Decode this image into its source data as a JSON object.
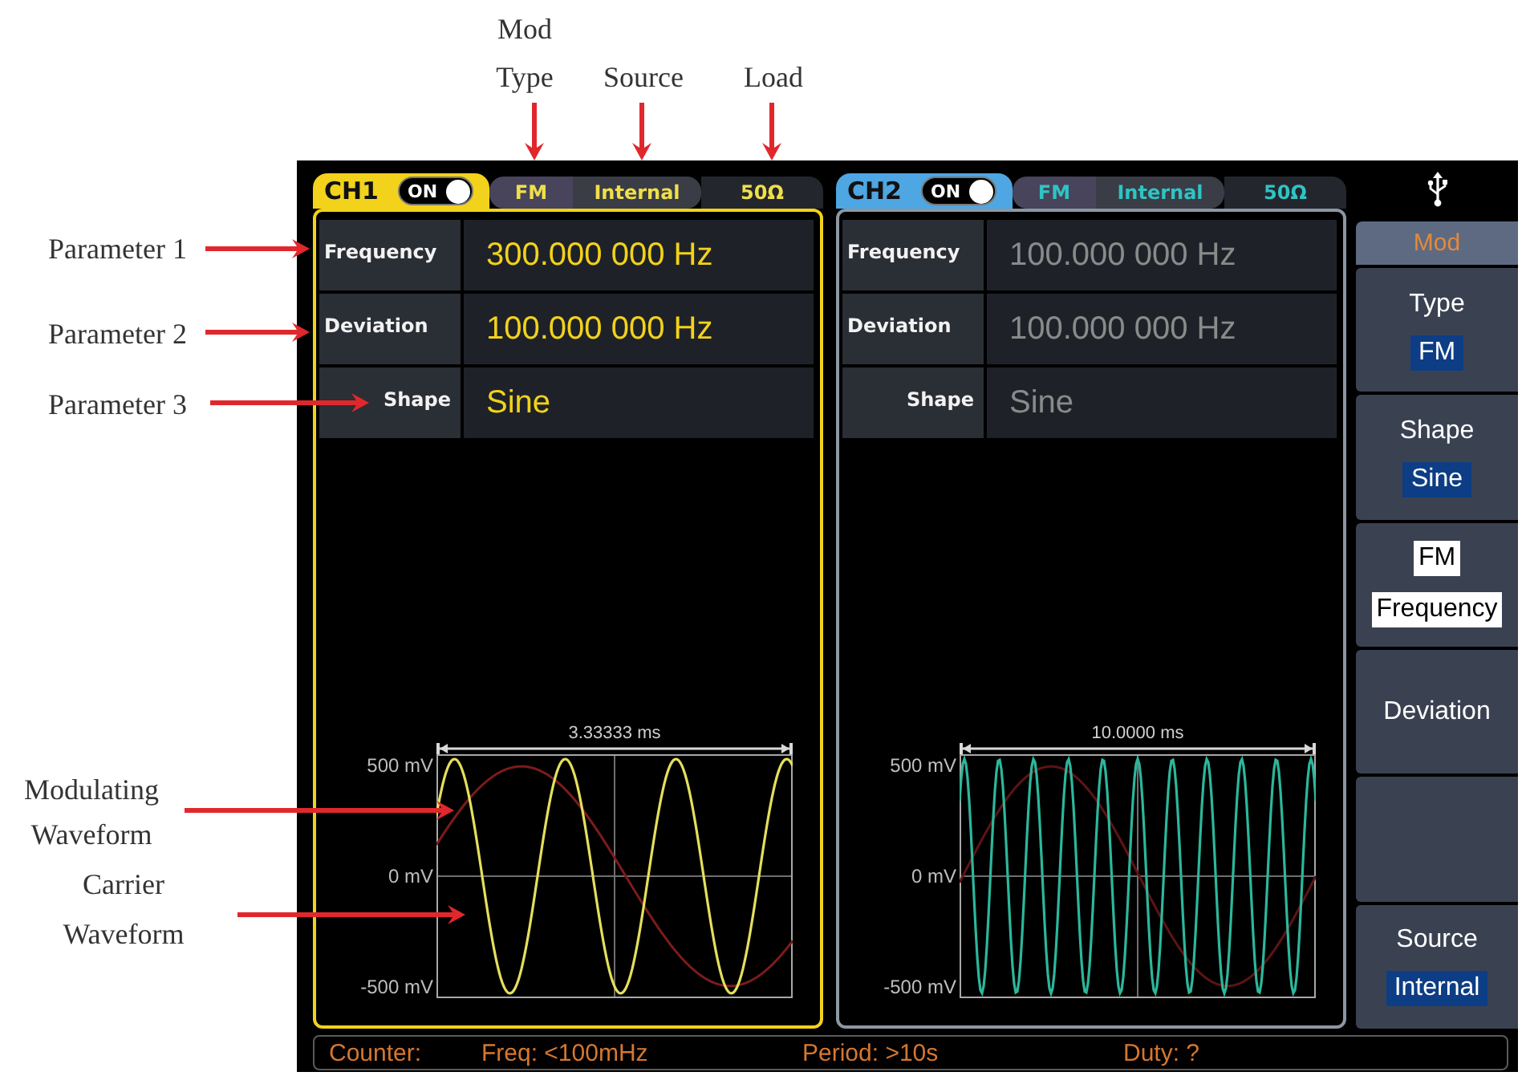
{
  "callouts": {
    "top": [
      "Mod Type",
      "Source",
      "Load"
    ],
    "left": [
      "Parameter 1",
      "Parameter 2",
      "Parameter 3",
      "Modulating Waveform",
      "Carrier Waveform"
    ]
  },
  "channels": [
    {
      "name": "CH1",
      "color": "#f2d21b",
      "selected": true,
      "on": true,
      "toggle_label": "ON",
      "mod_type": "FM",
      "source": "Internal",
      "load": "50Ω",
      "parameters": [
        {
          "kind": "number",
          "label": "Frequency",
          "value": "300.000 000 Hz"
        },
        {
          "kind": "number",
          "label": "Deviation",
          "value": "100.000 000 Hz"
        },
        {
          "kind": "option",
          "label": "Shape",
          "value": "Sine"
        }
      ],
      "waveform": {
        "time_span": "3.33333 ms",
        "y_labels": [
          "500 mV",
          "0 mV",
          "-500 mV"
        ]
      }
    },
    {
      "name": "CH2",
      "color": "#4ea6e2",
      "selected": false,
      "on": true,
      "toggle_label": "ON",
      "mod_type": "FM",
      "source": "Internal",
      "load": "50Ω",
      "parameters": [
        {
          "kind": "number",
          "label": "Frequency",
          "value": "100.000 000 Hz"
        },
        {
          "kind": "number",
          "label": "Deviation",
          "value": "100.000 000 Hz"
        },
        {
          "kind": "option",
          "label": "Shape",
          "value": "Sine"
        }
      ],
      "waveform": {
        "time_span": "10.0000 ms",
        "y_labels": [
          "500 mV",
          "0 mV",
          "-500 mV"
        ]
      }
    }
  ],
  "menu": {
    "title": "Mod",
    "items": [
      {
        "kind": "option",
        "label": "Type",
        "value": "FM",
        "selected": false
      },
      {
        "kind": "option",
        "label": "Shape",
        "value": "Sine",
        "selected": false
      },
      {
        "kind": "option",
        "label": "FM",
        "value": "Frequency",
        "selected": true
      },
      {
        "kind": "action",
        "label": "Deviation",
        "selected": false
      },
      {
        "kind": "blank",
        "selected": false
      },
      {
        "kind": "option",
        "label": "Source",
        "value": "Internal",
        "selected": false
      }
    ]
  },
  "status_bar": {
    "label": "Counter:",
    "readings": [
      "Freq: <100mHz",
      "Period: >10s",
      "Duty: ?"
    ]
  }
}
